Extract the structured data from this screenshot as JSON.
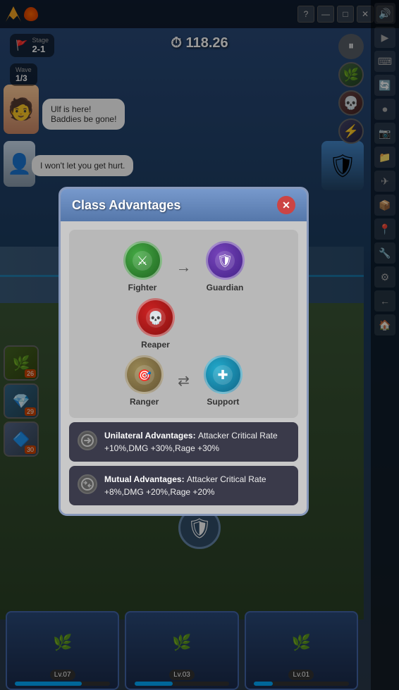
{
  "topbar": {
    "controls": [
      "?",
      "—",
      "□",
      "✕",
      "«"
    ]
  },
  "stage": {
    "label": "Stage",
    "number": "2-1"
  },
  "wave": {
    "label": "Wave",
    "current": "1",
    "total": "3"
  },
  "timer": {
    "icon": "⏱",
    "value": "118.26"
  },
  "bubbles": [
    {
      "text": "Ulf is here!\nBaddies be gone!"
    },
    {
      "text": "I won't let you get hurt."
    }
  ],
  "abilities": [
    {
      "badge": "26"
    },
    {
      "badge": "29"
    },
    {
      "badge": "30"
    }
  ],
  "cards": [
    {
      "level": "Lv.07",
      "fill": 70
    },
    {
      "level": "Lv.03",
      "fill": 40
    },
    {
      "level": "Lv.01",
      "fill": 20
    }
  ],
  "modal": {
    "title": "Class Advantages",
    "close_label": "✕",
    "classes": [
      {
        "name": "Fighter",
        "emoji": "⚔",
        "color": "fighter"
      },
      {
        "name": "Guardian",
        "emoji": "🛡",
        "color": "guardian"
      },
      {
        "name": "Reaper",
        "emoji": "💀",
        "color": "reaper"
      },
      {
        "name": "Ranger",
        "emoji": "🎯",
        "color": "ranger"
      },
      {
        "name": "Support",
        "emoji": "✚",
        "color": "support"
      }
    ],
    "advantages": [
      {
        "type": "Unilateral Advantages:",
        "desc": "Attacker Critical Rate +10%,DMG +30%,Rage +30%"
      },
      {
        "type": "Mutual Advantages:",
        "desc": "Attacker Critical Rate +8%,DMG +20%,Rage +20%"
      }
    ]
  },
  "toolbar": {
    "items": [
      "🔊",
      "▶",
      "⌨",
      "🔄",
      "⏺",
      "📷",
      "📁",
      "✈",
      "📦",
      "📍",
      "🔧",
      "⚙",
      "←",
      "🏠"
    ]
  }
}
